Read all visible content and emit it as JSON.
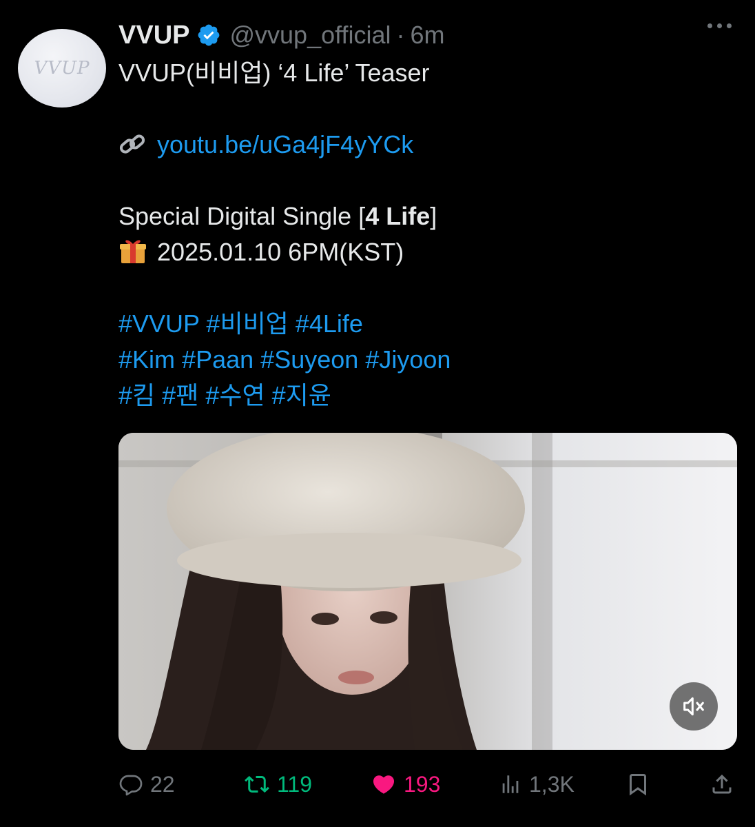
{
  "tweet": {
    "display_name": "VVUP",
    "handle": "@vvup_official",
    "separator": "·",
    "time": "6m",
    "avatar_text": "VVUP",
    "lines": {
      "title": "VVUP(비비업) ‘4 Life’ Teaser",
      "link": "youtu.be/uGa4jF4yYCk",
      "single_prefix": "Special Digital Single [",
      "single_bold": "4 Life",
      "single_suffix": "]",
      "date": "2025.01.10 6PM(KST)"
    },
    "hashtags": [
      [
        "#VVUP",
        "#비비업",
        "#4Life"
      ],
      [
        "#Kim",
        "#Paan",
        "#Suyeon",
        "#Jiyoon"
      ],
      [
        "#킴",
        "#팬",
        "#수연",
        "#지윤"
      ]
    ]
  },
  "actions": {
    "replies": "22",
    "retweets": "119",
    "likes": "193",
    "views": "1,3K"
  },
  "colors": {
    "background": "#000000",
    "text": "#e7e9ea",
    "muted": "#71767b",
    "link": "#1d9bf0",
    "retweet_active": "#00ba7c",
    "like_active": "#f91880"
  },
  "icons": {
    "verified": "verified-badge-icon",
    "more": "more-options-icon",
    "link_emoji": "link-icon",
    "gift_emoji": "gift-icon",
    "mute": "muted-speaker-icon",
    "reply": "reply-bubble-icon",
    "retweet": "retweet-icon",
    "like": "heart-icon",
    "views": "views-chart-icon",
    "bookmark": "bookmark-icon",
    "share": "share-icon"
  }
}
